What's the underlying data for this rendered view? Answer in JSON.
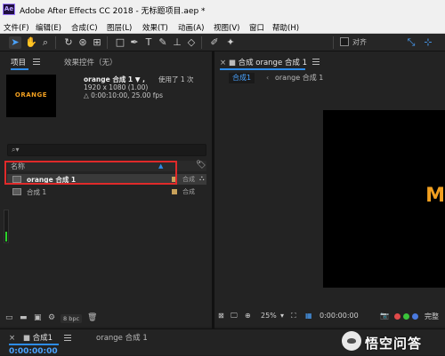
{
  "window": {
    "title": "Adobe After Effects CC 2018 - 无标题项目.aep *",
    "app_badge": "Ae"
  },
  "menu": [
    "文件(F)",
    "编辑(E)",
    "合成(C)",
    "图层(L)",
    "效果(T)",
    "动画(A)",
    "视图(V)",
    "窗口",
    "帮助(H)"
  ],
  "toolbar": {
    "snap_label": "对齐"
  },
  "project_panel": {
    "tab_project": "项目",
    "tab_effects": "效果控件（无）",
    "thumbnail_text": "ORANGE",
    "comp_name": "orange 合成 1 ▼ ,",
    "used": "使用了 1 次",
    "resolution": "1920 x 1080 (1.00)",
    "duration": "△ 0:00:10:00, 25.00 fps",
    "column_name": "名称",
    "items": [
      {
        "name": "orange 合成 1",
        "type": "合成",
        "selected": true
      },
      {
        "name": "合成 1",
        "type": "合成",
        "selected": false
      }
    ],
    "bit_depth": "8 bpc",
    "audio_level": 0.3
  },
  "viewer": {
    "tab_label": "合成 orange 合成 1",
    "breadcrumb_active": "合成1",
    "breadcrumb_next": "orange 合成 1",
    "canvas_text": "M",
    "zoom": "25%",
    "timecode": "0:00:00:00",
    "quality": "完整"
  },
  "timeline": {
    "tab_active": "合成1",
    "tab_other": "orange 合成 1",
    "timecode": "0:00:00:00"
  },
  "watermark": {
    "text": "悟空问答"
  },
  "colors": {
    "accent": "#2d8ceb",
    "highlight_box": "#e02a2a",
    "brand_orange": "#f2a020"
  }
}
